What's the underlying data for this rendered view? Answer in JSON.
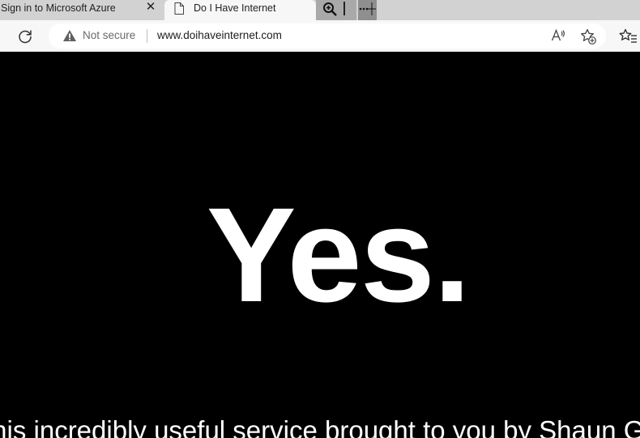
{
  "tabs": [
    {
      "title": "Sign in to Microsoft Azure",
      "active": false,
      "close_symbol": "✕",
      "icon": "none"
    },
    {
      "title": "Do I Have Internet",
      "active": true,
      "icon": "page-icon"
    }
  ],
  "tab_tools": {
    "zoom_icon": "zoom-in-icon",
    "more_icon": "more-icon"
  },
  "navbar": {
    "refresh_icon": "refresh-icon",
    "security_icon": "warning-icon",
    "security_text": "Not secure",
    "url": "www.doihaveinternet.com",
    "read_aloud_icon": "read-aloud-icon",
    "add_favorite_icon": "add-favorite-icon",
    "favorites_icon": "favorites-icon"
  },
  "page": {
    "answer": "Yes.",
    "credit": "This incredibly useful service brought to you by Shaun Gr",
    "background_color": "#000000",
    "text_color": "#ffffff"
  }
}
